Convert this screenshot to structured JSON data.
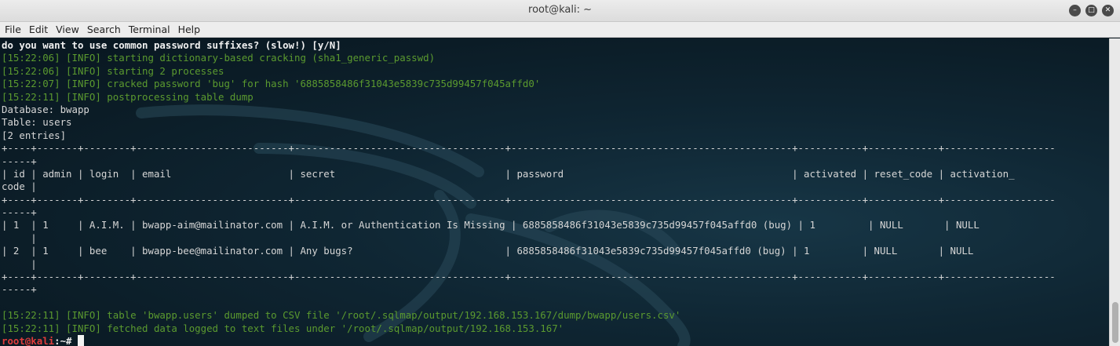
{
  "window": {
    "title": "root@kali: ~"
  },
  "menu": [
    "File",
    "Edit",
    "View",
    "Search",
    "Terminal",
    "Help"
  ],
  "terminal": {
    "lines": [
      {
        "text": "do you want to use common password suffixes? (slow!) [y/N]",
        "style": "bold"
      },
      {
        "text": "[15:22:06] [INFO] starting dictionary-based cracking (sha1_generic_passwd)",
        "style": "info"
      },
      {
        "text": "[15:22:06] [INFO] starting 2 processes",
        "style": "info"
      },
      {
        "text": "[15:22:07] [INFO] cracked password 'bug' for hash '6885858486f31043e5839c735d99457f045affd0'",
        "style": "info"
      },
      {
        "text": "[15:22:11] [INFO] postprocessing table dump",
        "style": "info"
      },
      {
        "text": "Database: bwapp",
        "style": "plain"
      },
      {
        "text": "Table: users",
        "style": "plain"
      },
      {
        "text": "[2 entries]",
        "style": "plain"
      },
      {
        "text": "+----+-------+--------+--------------------------+------------------------------------+------------------------------------------------+-----------+------------+-------------------",
        "style": "plain"
      },
      {
        "text": "-----+",
        "style": "plain"
      },
      {
        "text": "| id | admin | login  | email                    | secret                             | password                                       | activated | reset_code | activation_",
        "style": "plain"
      },
      {
        "text": "code |",
        "style": "plain"
      },
      {
        "text": "+----+-------+--------+--------------------------+------------------------------------+------------------------------------------------+-----------+------------+-------------------",
        "style": "plain"
      },
      {
        "text": "-----+",
        "style": "plain"
      },
      {
        "text": "| 1  | 1     | A.I.M. | bwapp-aim@mailinator.com | A.I.M. or Authentication Is Missing | 6885858486f31043e5839c735d99457f045affd0 (bug) | 1         | NULL       | NULL",
        "style": "plain"
      },
      {
        "text": "     |",
        "style": "plain"
      },
      {
        "text": "| 2  | 1     | bee    | bwapp-bee@mailinator.com | Any bugs?                          | 6885858486f31043e5839c735d99457f045affd0 (bug) | 1         | NULL       | NULL",
        "style": "plain"
      },
      {
        "text": "     |",
        "style": "plain"
      },
      {
        "text": "+----+-------+--------+--------------------------+------------------------------------+------------------------------------------------+-----------+------------+-------------------",
        "style": "plain"
      },
      {
        "text": "-----+",
        "style": "plain"
      },
      {
        "text": "",
        "style": "plain"
      },
      {
        "text": "[15:22:11] [INFO] table 'bwapp.users' dumped to CSV file '/root/.sqlmap/output/192.168.153.167/dump/bwapp/users.csv'",
        "style": "info"
      },
      {
        "text": "[15:22:11] [INFO] fetched data logged to text files under '/root/.sqlmap/output/192.168.153.167'",
        "style": "info"
      }
    ],
    "prompt": {
      "user_host": "root@kali",
      "rest": ":~# "
    }
  },
  "colors": {
    "info": "#5b9a2f",
    "prompt_user": "#e03c3c",
    "background": "#0d1a22"
  }
}
